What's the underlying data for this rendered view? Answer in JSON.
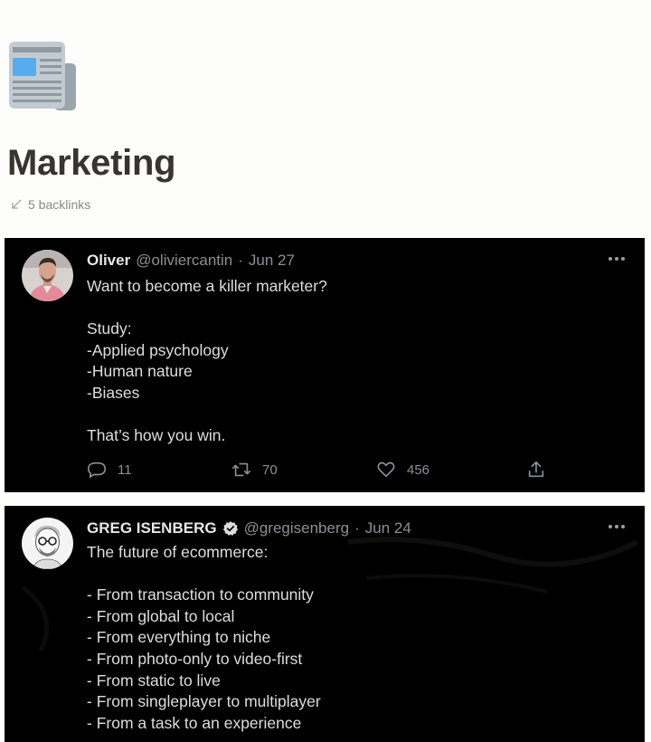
{
  "page": {
    "icon": "newspaper-icon",
    "title": "Marketing",
    "backlinks": "5 backlinks"
  },
  "tweets": [
    {
      "author": "Oliver",
      "handle": "@oliviercantin",
      "separator": "·",
      "date": "Jun 27",
      "verified": false,
      "text": "Want to become a killer marketer?\n\nStudy:\n-Applied psychology\n-Human nature\n-Biases\n\nThat’s how you win.",
      "replies": "11",
      "retweets": "70",
      "likes": "456"
    },
    {
      "author": "GREG ISENBERG",
      "handle": "@gregisenberg",
      "separator": "·",
      "date": "Jun 24",
      "verified": true,
      "text": "The future of ecommerce:\n\n- From transaction to community\n- From global to local\n- From everything to niche\n- From photo-only to video-first\n- From static to live\n- From singleplayer to multiplayer\n- From a task to an experience"
    }
  ],
  "colors": {
    "page_bg": "#fdfdfc",
    "title": "#37352f",
    "tweet_bg": "#000000",
    "muted": "#8b9096"
  }
}
